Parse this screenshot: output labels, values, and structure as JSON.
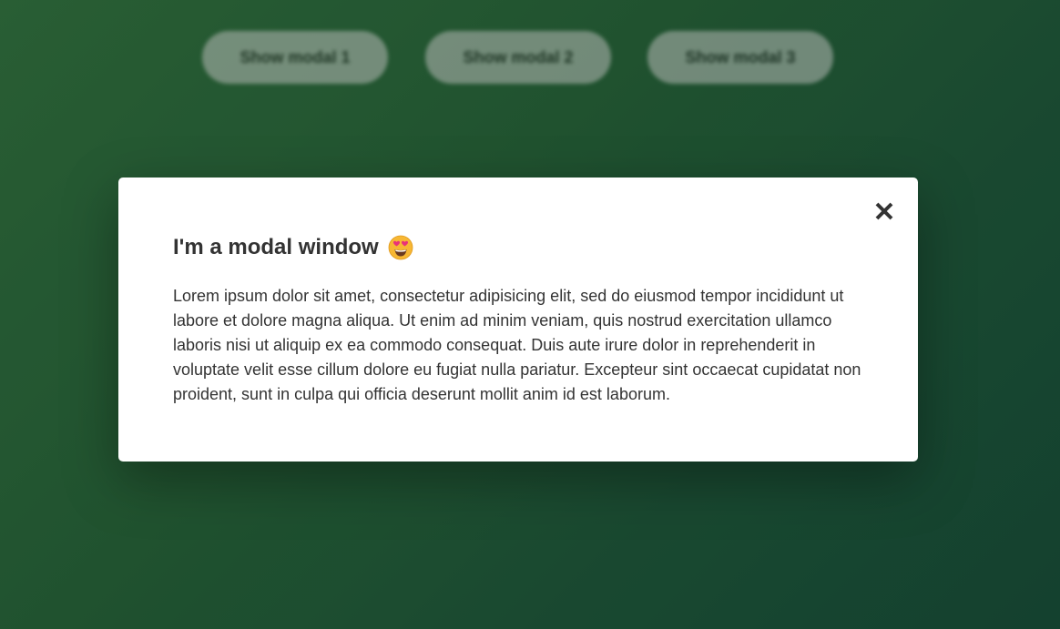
{
  "background_buttons": [
    {
      "label": "Show modal 1"
    },
    {
      "label": "Show modal 2"
    },
    {
      "label": "Show modal 3"
    }
  ],
  "modal": {
    "title": "I'm a modal window",
    "title_emoji_icon": "smiling-face-with-heart-eyes-icon",
    "body": "Lorem ipsum dolor sit amet, consectetur adipisicing elit, sed do eiusmod tempor incididunt ut labore et dolore magna aliqua. Ut enim ad minim veniam, quis nostrud exercitation ullamco laboris nisi ut aliquip ex ea commodo consequat. Duis aute irure dolor in reprehenderit in voluptate velit esse cillum dolore eu fugiat nulla pariatur. Excepteur sint occaecat cupidatat non proident, sunt in culpa qui officia deserunt mollit anim id est laborum.",
    "close_icon": "close-icon"
  },
  "colors": {
    "background_start": "#2f6b3c",
    "background_end": "#174a36",
    "modal_background": "#ffffff",
    "text": "#333333"
  }
}
